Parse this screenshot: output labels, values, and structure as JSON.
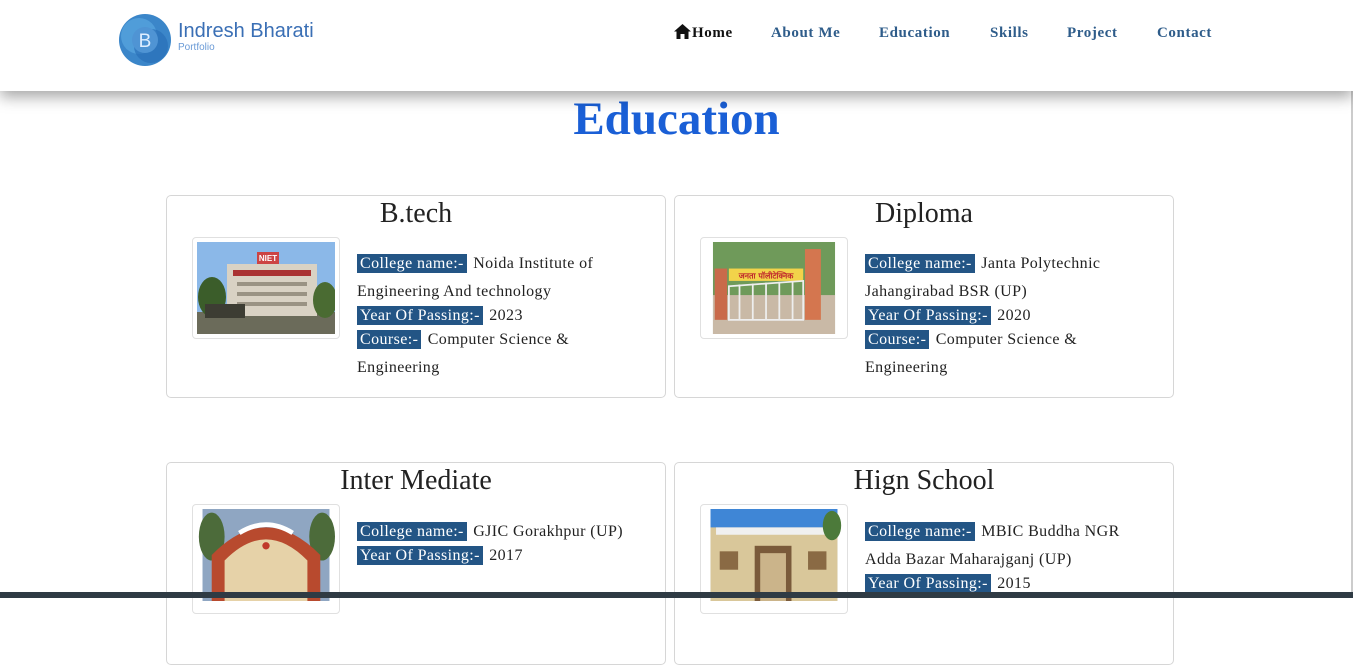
{
  "brand": {
    "logo_letter": "B",
    "name": "Indresh Bharati",
    "subtitle": "Portfolio"
  },
  "nav": [
    {
      "label": "Home",
      "icon": "home-icon"
    },
    {
      "label": "About Me"
    },
    {
      "label": "Education"
    },
    {
      "label": "Skills"
    },
    {
      "label": "Project"
    },
    {
      "label": "Contact"
    }
  ],
  "section_title": "Education",
  "labels": {
    "college": "College name:-",
    "year": "Year Of Passing:-",
    "course": "Course:-"
  },
  "cards": [
    {
      "title": "B.tech",
      "college": "Noida Institute of Engineering And technology",
      "year": "2023",
      "course": "Computer Science & Engineering",
      "sign_text": "NIET"
    },
    {
      "title": "Diploma",
      "college": "Janta Polytechnic Jahangirabad BSR (UP)",
      "year": "2020",
      "course": "Computer Science & Engineering",
      "sign_text": "जनता पॉलीटेक्निक"
    },
    {
      "title": "Inter Mediate",
      "college": "GJIC Gorakhpur (UP)",
      "year": "2017"
    },
    {
      "title": "Hign School",
      "college": "MBIC Buddha NGR Adda Bazar Maharajganj (UP)",
      "year": "2015"
    }
  ],
  "colors": {
    "heading": "#1a5fd6",
    "nav": "#2e5c8a",
    "label_bg": "#235585",
    "brand": "#3a6fb5"
  }
}
